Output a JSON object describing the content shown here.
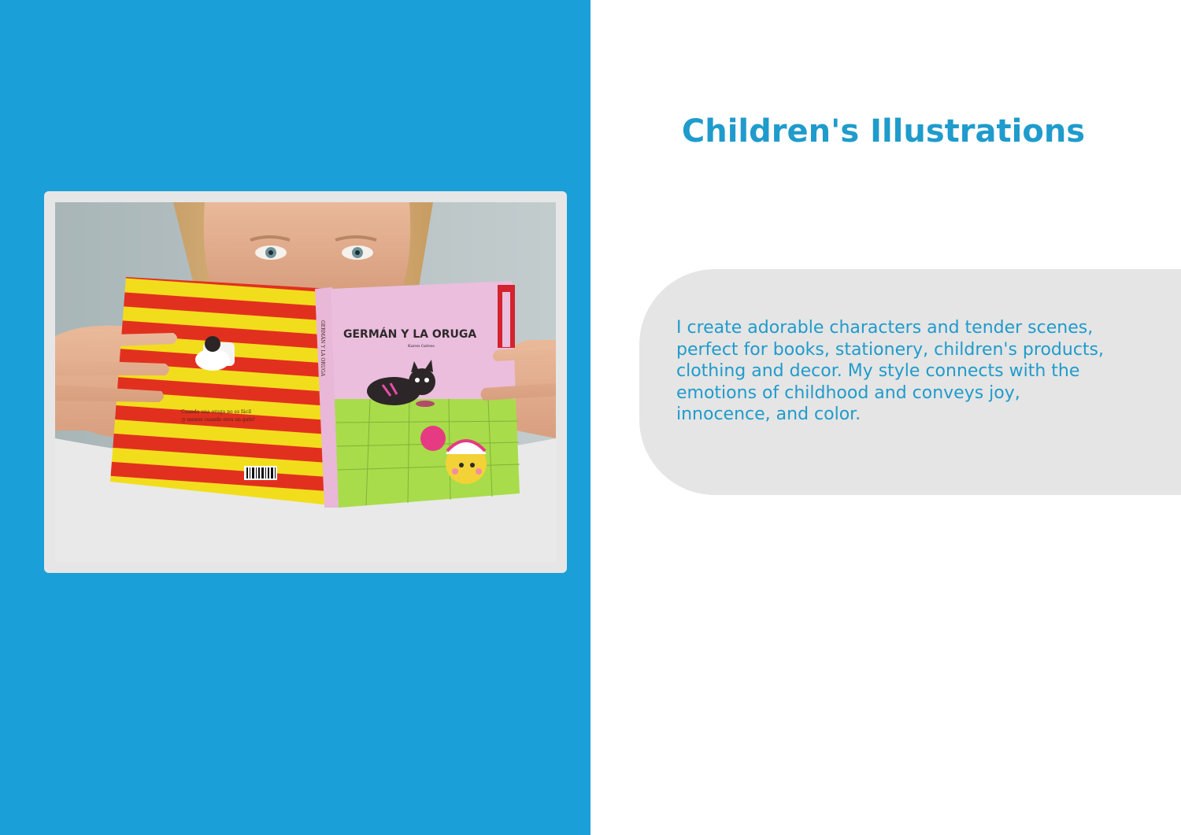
{
  "page": {
    "title": "Children's Illustrations",
    "description": "I create  adorable characters and tender scenes, perfect for books, stationery, children's products, clothing and decor. My style connects with the emotions of childhood and conveys joy, innocence, and color."
  },
  "photo": {
    "book_cover_title": "GERMÁN Y LA ORUGA",
    "book_author": "Karen Galves",
    "book_spine_title": "GERMÁN Y LA ORUGA",
    "book_back_text_line1": "Cuando una oruga no es fácil",
    "book_back_text_line2": "¡y menos cuando eres un gato!"
  },
  "colors": {
    "panel_blue": "#1b9fd9",
    "accent_text": "#1f9bcc",
    "box_gray": "#e5e5e5"
  }
}
